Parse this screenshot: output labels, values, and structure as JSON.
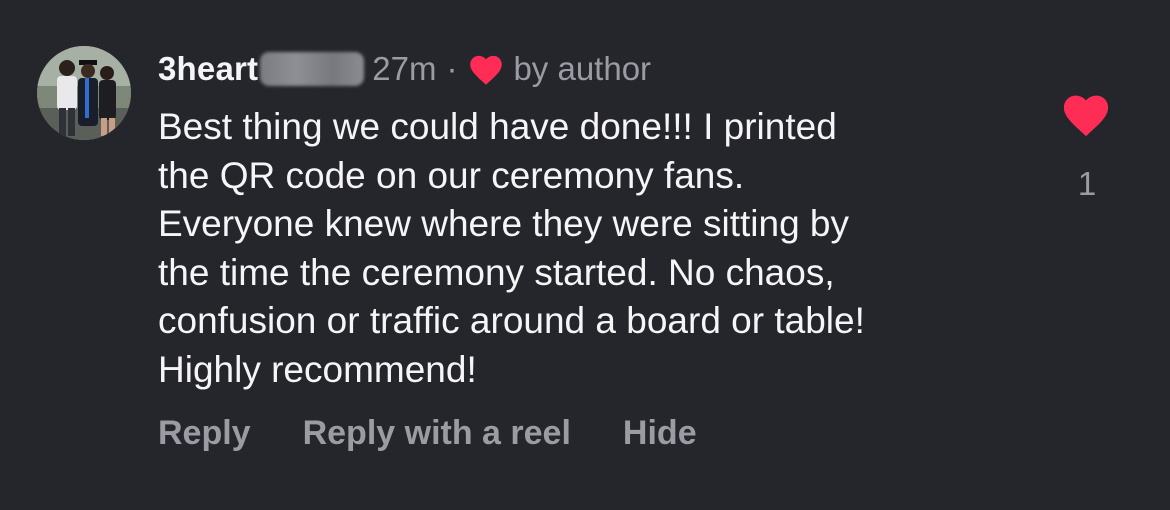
{
  "comment": {
    "username": "3heart",
    "time": "27m",
    "separator": "·",
    "liked_by": "by author",
    "body_lines": [
      "Best thing we could have done!!! I printed",
      "the QR code on our ceremony fans.",
      "Everyone knew where they were sitting by",
      "the time the ceremony started. No chaos,",
      "confusion or traffic around a board or table!",
      "Highly recommend!"
    ],
    "like_count": "1",
    "actions": {
      "reply": "Reply",
      "reply_reel": "Reply with a reel",
      "hide": "Hide"
    }
  },
  "icons": {
    "small_heart": "heart-icon",
    "like": "heart-icon"
  },
  "colors": {
    "background": "#25262b",
    "text": "#f5f5f7",
    "muted": "#9a9ba3",
    "heart": "#ff2d55"
  }
}
